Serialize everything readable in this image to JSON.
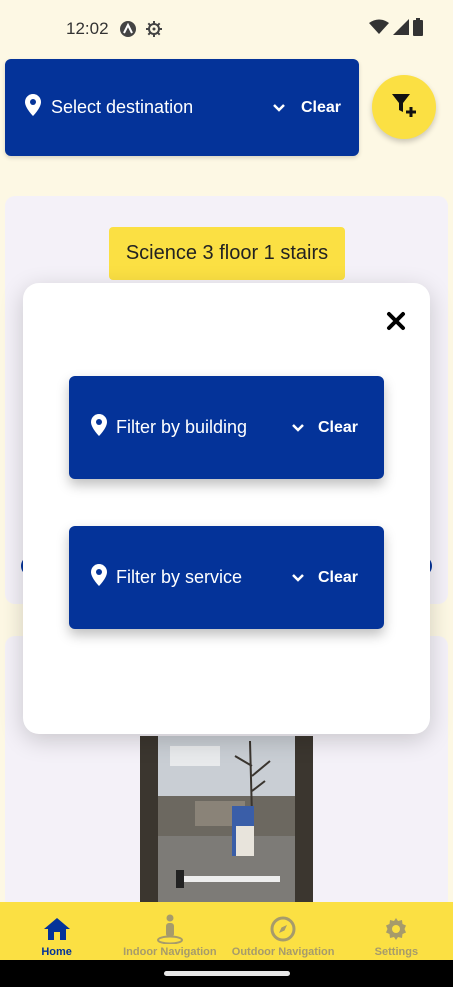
{
  "status_bar": {
    "time": "12:02"
  },
  "destination": {
    "label": "Select destination",
    "clear_label": "Clear"
  },
  "selected_place": {
    "label": "Science 3 floor 1 stairs"
  },
  "filter_modal": {
    "building_filter": {
      "label": "Filter by building",
      "clear_label": "Clear"
    },
    "service_filter": {
      "label": "Filter by service",
      "clear_label": "Clear"
    }
  },
  "bottom_nav": {
    "items": [
      {
        "label": "Home",
        "icon": "home-icon",
        "active": true
      },
      {
        "label": "Indoor Navigation",
        "icon": "person-pin-icon",
        "active": false
      },
      {
        "label": "Outdoor Navigation",
        "icon": "compass-icon",
        "active": false
      },
      {
        "label": "Settings",
        "icon": "gear-icon",
        "active": false
      }
    ]
  },
  "colors": {
    "primary": "#043399",
    "accent": "#fbe043",
    "background": "#fdf8e4",
    "inactive_nav": "#a69b6b"
  }
}
